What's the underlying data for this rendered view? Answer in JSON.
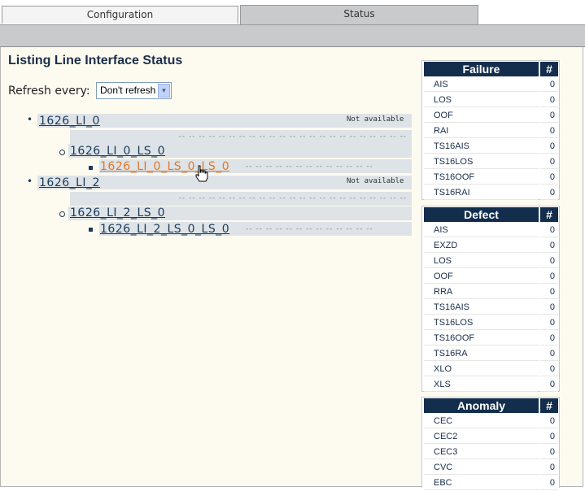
{
  "tabs": [
    {
      "label": "Configuration",
      "active": false
    },
    {
      "label": "Status",
      "active": true
    }
  ],
  "page": {
    "title": "Listing Line Interface Status",
    "refresh_label": "Refresh every:",
    "refresh_value": "Don't refresh"
  },
  "tree": {
    "li0": {
      "label": "1626_LI_0",
      "status": "Not available"
    },
    "li0_ls0": {
      "label": "1626_LI_0_LS_0"
    },
    "li0_ls0_ls0": {
      "label": "1626_LI_0_LS_0_LS_0"
    },
    "li2": {
      "label": "1626_LI_2",
      "status": "Not available"
    },
    "li2_ls0": {
      "label": "1626_LI_2_LS_0"
    },
    "li2_ls0_ls0": {
      "label": "1626_LI_2_LS_0_LS_0"
    }
  },
  "failure": {
    "header": "Failure",
    "count_header": "#",
    "rows": [
      {
        "k": "AIS",
        "v": "0"
      },
      {
        "k": "LOS",
        "v": "0"
      },
      {
        "k": "OOF",
        "v": "0"
      },
      {
        "k": "RAI",
        "v": "0"
      },
      {
        "k": "TS16AIS",
        "v": "0"
      },
      {
        "k": "TS16LOS",
        "v": "0"
      },
      {
        "k": "TS16OOF",
        "v": "0"
      },
      {
        "k": "TS16RAI",
        "v": "0"
      }
    ]
  },
  "defect": {
    "header": "Defect",
    "count_header": "#",
    "rows": [
      {
        "k": "AIS",
        "v": "0"
      },
      {
        "k": "EXZD",
        "v": "0"
      },
      {
        "k": "LOS",
        "v": "0"
      },
      {
        "k": "OOF",
        "v": "0"
      },
      {
        "k": "RRA",
        "v": "0"
      },
      {
        "k": "TS16AIS",
        "v": "0"
      },
      {
        "k": "TS16LOS",
        "v": "0"
      },
      {
        "k": "TS16OOF",
        "v": "0"
      },
      {
        "k": "TS16RA",
        "v": "0"
      },
      {
        "k": "XLO",
        "v": "0"
      },
      {
        "k": "XLS",
        "v": "0"
      }
    ]
  },
  "anomaly": {
    "header": "Anomaly",
    "count_header": "#",
    "rows": [
      {
        "k": "CEC",
        "v": "0"
      },
      {
        "k": "CEC2",
        "v": "0"
      },
      {
        "k": "CEC3",
        "v": "0"
      },
      {
        "k": "CVC",
        "v": "0"
      },
      {
        "k": "EBC",
        "v": "0"
      }
    ]
  },
  "colors": {
    "header_bg": "#132e4c",
    "link": "#1a3a5c",
    "link_hover": "#e0772d",
    "row_bg": "#dde3e6",
    "page_bg": "#fdfbf0"
  }
}
